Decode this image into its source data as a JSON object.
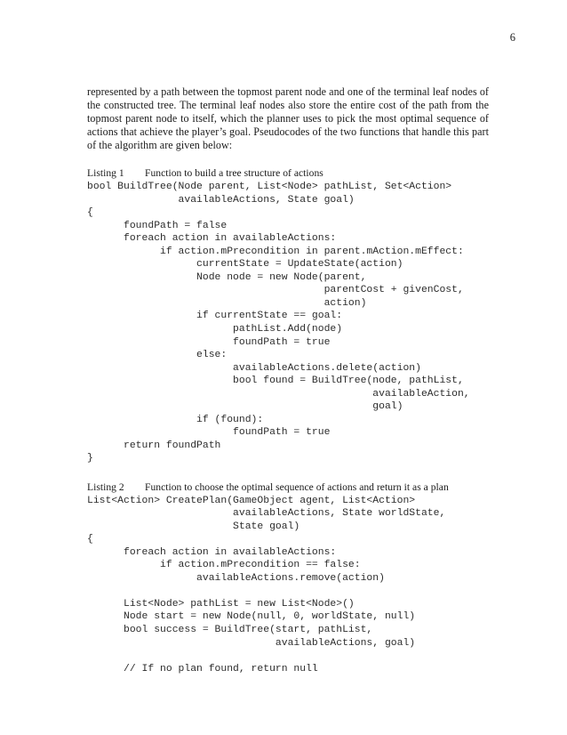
{
  "document": {
    "page_number": "6",
    "paragraph": "represented by a path between the topmost parent node and one of the terminal leaf nodes of the constructed tree. The terminal leaf nodes also store the entire cost of the path from the topmost parent node to itself, which the planner uses to pick the most optimal sequence of actions that achieve the player’s goal. Pseudocodes of the two functions that handle this part of the algorithm are given below:",
    "listing1": {
      "heading": "Listing 1    Function to build a tree structure of actions",
      "label": "Listing 1",
      "caption": "Function to build a tree structure of actions",
      "code": "bool BuildTree(Node parent, List<Node> pathList, Set<Action>\n               availableActions, State goal)\n{\n      foundPath = false\n      foreach action in availableActions:\n            if action.mPrecondition in parent.mAction.mEffect:\n                  currentState = UpdateState(action)\n                  Node node = new Node(parent,\n                                       parentCost + givenCost,\n                                       action)\n                  if currentState == goal:\n                        pathList.Add(node)\n                        foundPath = true\n                  else:\n                        availableActions.delete(action)\n                        bool found = BuildTree(node, pathList,\n                                               availableAction,\n                                               goal)\n                  if (found):\n                        foundPath = true\n      return foundPath\n}"
    },
    "listing2": {
      "heading": "Listing 2    Function to choose the optimal sequence of actions and return it as a plan",
      "label": "Listing 2",
      "caption": "Function to choose the optimal sequence of actions and return it as a plan",
      "code": "List<Action> CreatePlan(GameObject agent, List<Action>\n                        availableActions, State worldState,\n                        State goal)\n{\n      foreach action in availableActions:\n            if action.mPrecondition == false:\n                  availableActions.remove(action)\n\n      List<Node> pathList = new List<Node>()\n      Node start = new Node(null, 0, worldState, null)\n      bool success = BuildTree(start, pathList,\n                               availableActions, goal)\n\n      // If no plan found, return null"
    }
  }
}
